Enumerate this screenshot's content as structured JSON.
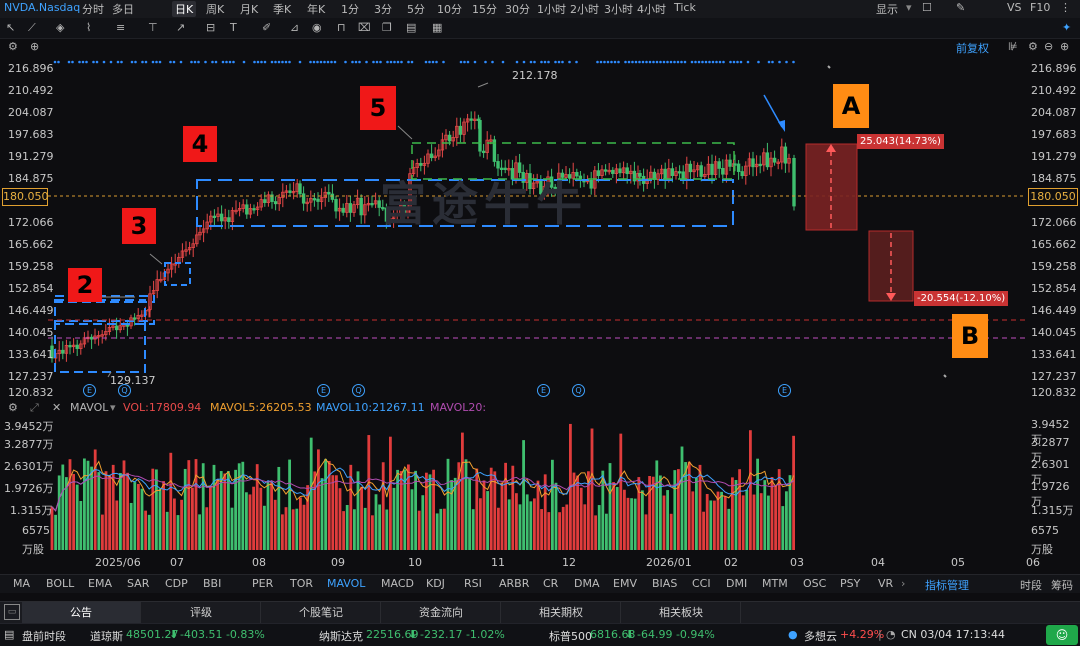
{
  "header": {
    "symbol": "NVDA.Nasdaq",
    "timeframes": [
      "分时",
      "多日",
      "日K",
      "周K",
      "月K",
      "季K",
      "年K",
      "1分",
      "3分",
      "5分",
      "10分",
      "15分",
      "30分",
      "1小时",
      "2小时",
      "3小时",
      "4小时",
      "Tick"
    ],
    "active_timeframe": "日K",
    "right_items": {
      "display": "显示",
      "vs": "VS",
      "f10": "F10"
    }
  },
  "chart_toolbar": {
    "adjust_label": "前复权"
  },
  "price_axis": {
    "ticks": [
      "216.896",
      "210.492",
      "204.087",
      "197.683",
      "191.279",
      "184.875",
      "180.050",
      "172.066",
      "165.662",
      "159.258",
      "152.854",
      "146.449",
      "140.045",
      "133.641",
      "127.237",
      "120.832"
    ],
    "current_price": "180.050"
  },
  "annotations": {
    "high_label": "212.178",
    "low_label": "129.137",
    "markers": [
      "2",
      "3",
      "4",
      "5"
    ],
    "marker_a": "A",
    "marker_b": "B",
    "up_move": "25.043(14.73%)",
    "down_move": "-20.554(-12.10%)",
    "watermark": "富途牛牛"
  },
  "volume_header": {
    "indicator": "MAVOL",
    "vol": "VOL:17809.94",
    "mavol5": "MAVOL5:26205.53",
    "mavol10": "MAVOL10:21267.11",
    "mavol20": "MAVOL20:"
  },
  "volume_axis": {
    "ticks": [
      "3.9452万",
      "3.2877万",
      "2.6301万",
      "1.9726万",
      "1.315万",
      "6575",
      "万股"
    ]
  },
  "date_axis": [
    "2025/06",
    "07",
    "08",
    "09",
    "10",
    "11",
    "12",
    "2026/01",
    "02",
    "03",
    "04",
    "05",
    "06"
  ],
  "indicator_tabs": [
    "MA",
    "BOLL",
    "EMA",
    "SAR",
    "CDP",
    "BBI",
    "PER",
    "TOR",
    "MAVOL",
    "MACD",
    "KDJ",
    "RSI",
    "ARBR",
    "CR",
    "DMA",
    "EMV",
    "BIAS",
    "CCI",
    "DMI",
    "MTM",
    "OSC",
    "PSY",
    "VR"
  ],
  "indicator_manage": "指标管理",
  "right_side_tabs": {
    "session": "时段",
    "chips": "筹码"
  },
  "bottom_tabs": [
    "公告",
    "评级",
    "个股笔记",
    "资金流向",
    "相关期权",
    "相关板块"
  ],
  "ticker": {
    "premarket": "盘前时段",
    "dow_name": "道琼斯",
    "dow_value": "48501.27",
    "dow_change": "-403.51 -0.83%",
    "nasdaq_name": "纳斯达克",
    "nasdaq_value": "22516.69",
    "nasdaq_change": "-232.17 -1.02%",
    "sp_name": "标普500",
    "sp_value": "6816.63",
    "sp_change": "-64.99 -0.94%",
    "cloud_name": "多想云",
    "cloud_change": "+4.29%",
    "clock": "CN 03/04 17:13:44"
  },
  "colors": {
    "accent": "#3ea2ff",
    "up": "#ff4d4d",
    "down": "#3fbf6f",
    "orange": "#ff8c14",
    "red": "#f01818"
  }
}
